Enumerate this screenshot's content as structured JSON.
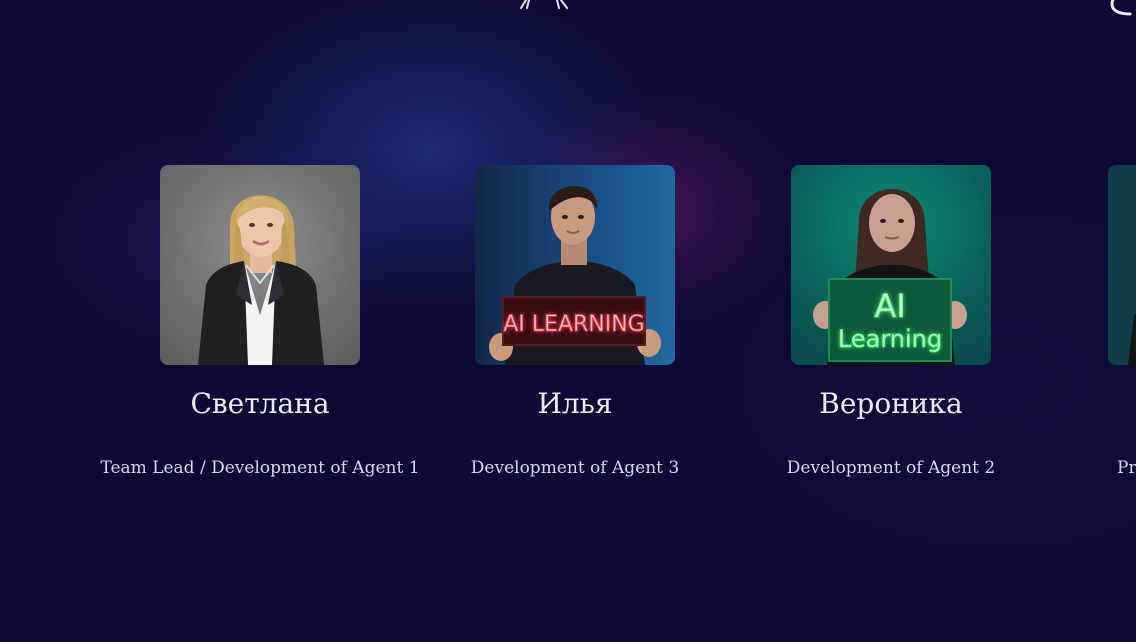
{
  "colors": {
    "background": "#0d0b35",
    "text": "#ecebf4",
    "neon_red": "#ff3b4a",
    "neon_green": "#5cff7a"
  },
  "team": {
    "members": [
      {
        "name": "Светлана",
        "role": "Team Lead / Development of Agent 1",
        "photo_icon": "portrait-woman-blazer",
        "sign_text": ""
      },
      {
        "name": "Илья",
        "role": "Development of Agent 3",
        "photo_icon": "portrait-man-neon-sign",
        "sign_text": "AI LEARNING"
      },
      {
        "name": "Вероника",
        "role": "Development of Agent 2",
        "photo_icon": "portrait-woman-neon-sign",
        "sign_line_1": "AI",
        "sign_line_2": "Learning"
      },
      {
        "role_partial": "Pro",
        "photo_icon": "portrait-partial"
      }
    ]
  }
}
